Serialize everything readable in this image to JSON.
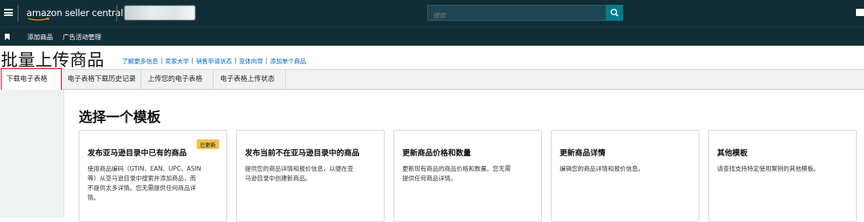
{
  "header": {
    "logo_text": "amazon seller central",
    "search_placeholder": "搜索",
    "colors": {
      "header_bg": "#112e37",
      "search_button": "#007d8c",
      "link": "#0066c0",
      "badge": "#f0c14b",
      "highlight": "#e02020"
    }
  },
  "subnav": {
    "items": [
      {
        "label": "添加商品"
      },
      {
        "label": "广告活动管理"
      }
    ]
  },
  "page": {
    "title": "批量上传商品",
    "links": [
      {
        "label": "了解更多信息"
      },
      {
        "label": "卖家大学"
      },
      {
        "label": "销售申请状态"
      },
      {
        "label": "变体向导"
      },
      {
        "label": "添加单个商品"
      }
    ]
  },
  "tabs": [
    {
      "label": "下载电子表格",
      "active": true
    },
    {
      "label": "电子表格下载历史记录",
      "active": false
    },
    {
      "label": "上传您的电子表格",
      "active": false
    },
    {
      "label": "电子表格上传状态",
      "active": false
    }
  ],
  "section": {
    "title": "选择一个模板",
    "cards": [
      {
        "title": "发布亚马逊目录中已有的商品",
        "badge": "已更新",
        "description": [
          "使用商品编码（GTIN、EAN、UPC、ASIN",
          "等）从亚马逊目录中搜索并添加商品，而",
          "不提供太多详情。您无需提供任何商品详",
          "情。"
        ]
      },
      {
        "title": "发布当前不在亚马逊目录中的商品",
        "badge": "",
        "description": [
          "提供您的商品详情和报价信息，以便在亚",
          "马逊目录中创建新商品。"
        ]
      },
      {
        "title": "更新商品价格和数量",
        "badge": "",
        "description": [
          "更新现有商品的商品价格和数量。您无需",
          "提供任何商品详情。"
        ]
      },
      {
        "title": "更新商品详情",
        "badge": "",
        "description": [
          "编辑您的商品详情和报价信息。"
        ]
      },
      {
        "title": "其他模板",
        "badge": "",
        "description": [
          "请查找支持特定使用案例的其他模板。"
        ]
      }
    ]
  }
}
